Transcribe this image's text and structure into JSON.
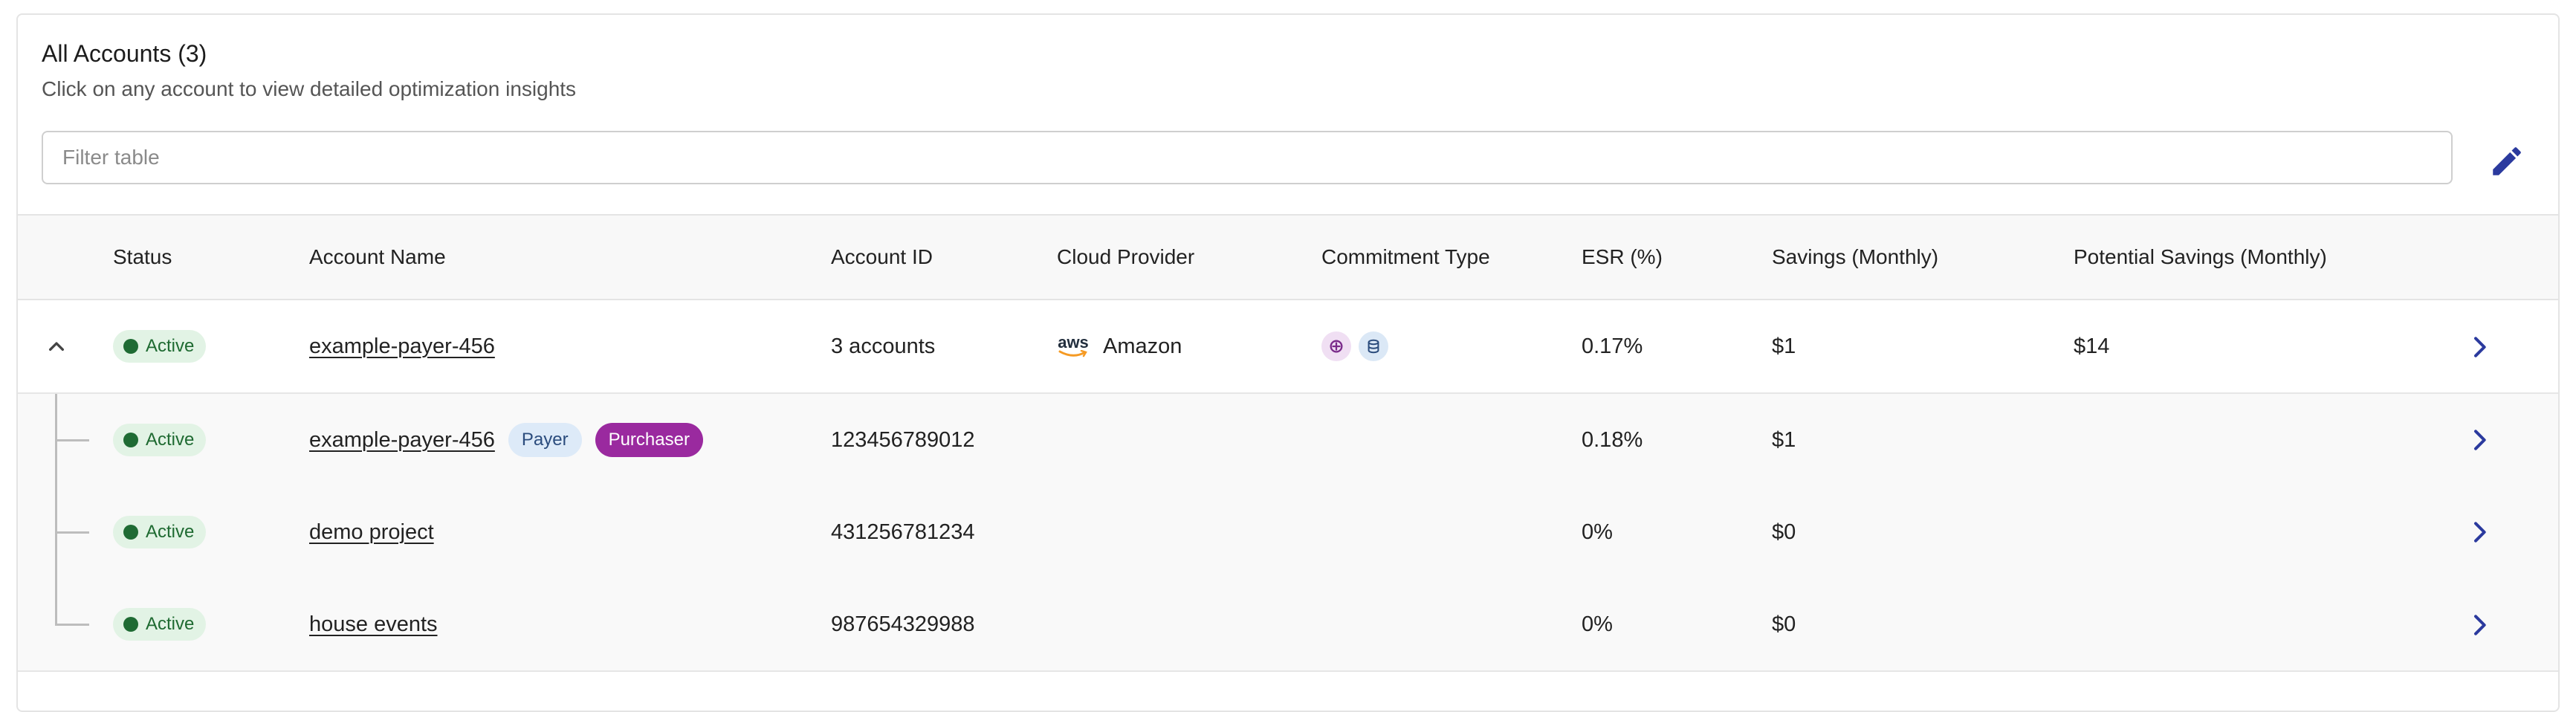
{
  "header": {
    "title": "All Accounts (3)",
    "subtitle": "Click on any account to view detailed optimization insights"
  },
  "filter": {
    "placeholder": "Filter table",
    "value": ""
  },
  "table": {
    "columns": [
      "Status",
      "Account Name",
      "Account ID",
      "Cloud Provider",
      "Commitment Type",
      "ESR (%)",
      "Savings (Monthly)",
      "Potential Savings (Monthly)"
    ],
    "parent_row": {
      "status": "Active",
      "account_name": "example-payer-456",
      "account_id": "3 accounts",
      "cloud_provider": "Amazon",
      "provider_logo_text": "aws",
      "commitment_icons": [
        "compute-plan-icon",
        "database-icon"
      ],
      "esr": "0.17%",
      "savings": "$1",
      "potential_savings": "$14"
    },
    "child_rows": [
      {
        "status": "Active",
        "account_name": "example-payer-456",
        "tags": [
          "Payer",
          "Purchaser"
        ],
        "account_id": "123456789012",
        "esr": "0.18%",
        "savings": "$1"
      },
      {
        "status": "Active",
        "account_name": "demo project",
        "account_id": "431256781234",
        "esr": "0%",
        "savings": "$0"
      },
      {
        "status": "Active",
        "account_name": "house events",
        "account_id": "987654329988",
        "esr": "0%",
        "savings": "$0"
      }
    ]
  },
  "colors": {
    "accent": "#2b3a9e",
    "active_badge_bg": "#e2f3e5",
    "active_badge_text": "#1e6a31",
    "payer_tag_bg": "#ddeaf8",
    "purchaser_tag_bg": "#9a2a9f",
    "aws_orange": "#f59a23"
  }
}
